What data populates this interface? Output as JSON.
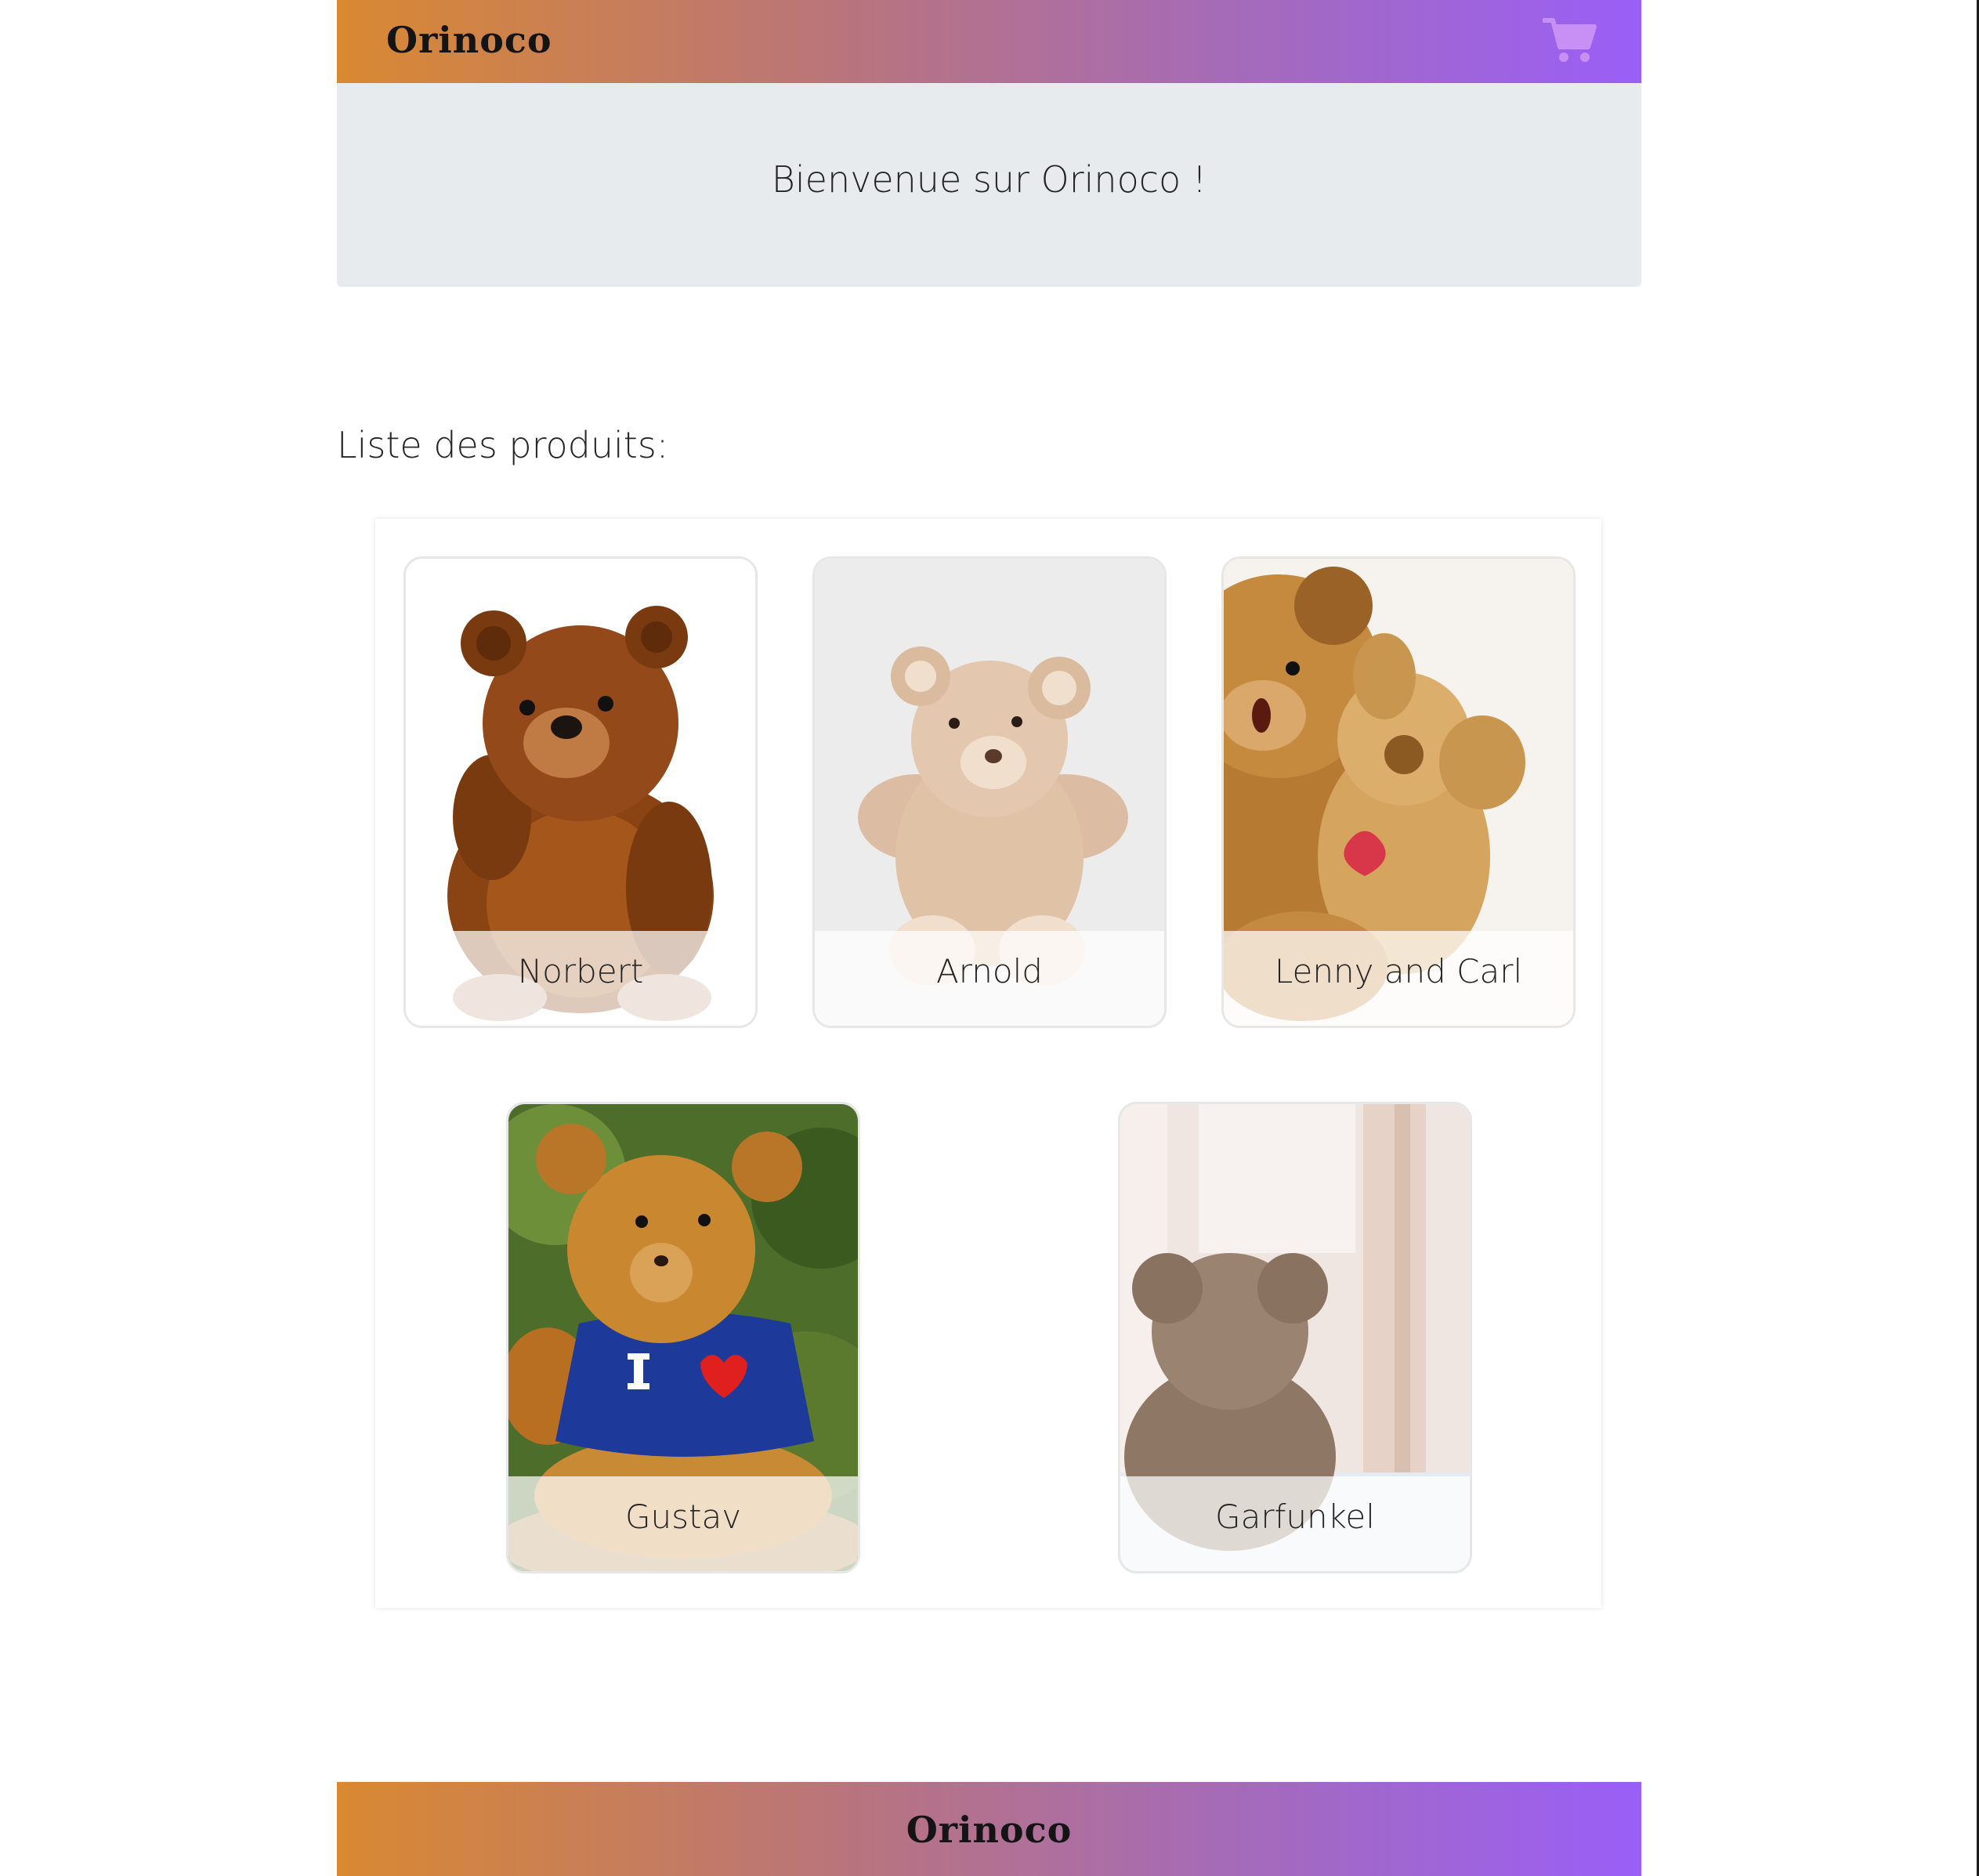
{
  "header": {
    "brand": "Orinoco",
    "cart_icon": "shopping-cart-icon"
  },
  "banner": {
    "welcome": "Bienvenue sur Orinoco !"
  },
  "products_section": {
    "title": "Liste des produits:",
    "items": [
      {
        "name": "Norbert"
      },
      {
        "name": "Arnold"
      },
      {
        "name": "Lenny and Carl"
      },
      {
        "name": "Gustav"
      },
      {
        "name": "Garfunkel"
      }
    ]
  },
  "footer": {
    "brand": "Orinoco"
  },
  "colors": {
    "gradient_start": "#d98931",
    "gradient_end": "#9a5ff7",
    "banner_bg": "#e8ebee"
  }
}
